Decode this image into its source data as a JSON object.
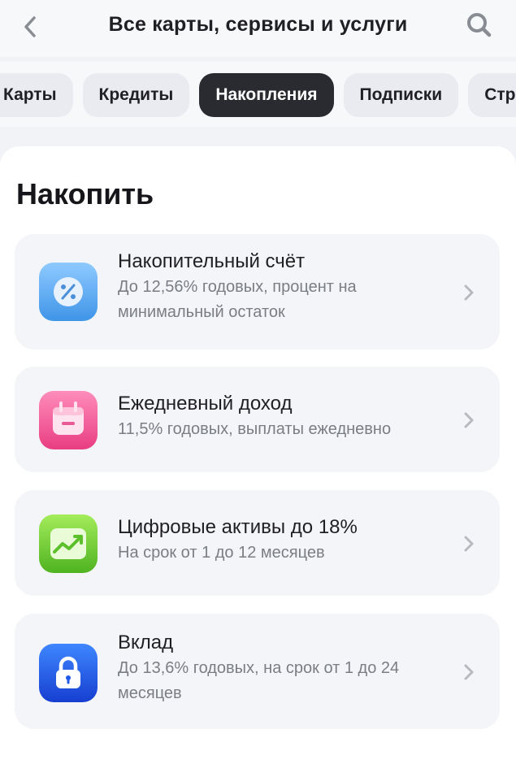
{
  "header": {
    "title": "Все карты, сервисы и услуги",
    "back_icon": "chevron-left-icon",
    "search_icon": "search-icon"
  },
  "tabs": [
    {
      "label": "Карты",
      "active": false
    },
    {
      "label": "Кредиты",
      "active": false
    },
    {
      "label": "Накопления",
      "active": true
    },
    {
      "label": "Подписки",
      "active": false
    },
    {
      "label": "Страхование",
      "active": false
    }
  ],
  "section": {
    "title": "Накопить",
    "items": [
      {
        "title": "Накопительный счёт",
        "subtitle": "До 12,56% годовых, процент на минимальный остаток",
        "icon": "percent-icon",
        "color": "#5aa8f0"
      },
      {
        "title": "Ежедневный доход",
        "subtitle": "11,5% годовых, выплаты ежедневно",
        "icon": "calendar-icon",
        "color": "#f2508f"
      },
      {
        "title": "Цифровые активы до 18%",
        "subtitle": "На срок от 1 до 12 месяцев",
        "icon": "chart-up-icon",
        "color": "#6fc92f"
      },
      {
        "title": "Вклад",
        "subtitle": "До 13,6% годовых, на срок от 1 до 24 месяцев",
        "icon": "lock-icon",
        "color": "#1f5be6"
      }
    ]
  }
}
